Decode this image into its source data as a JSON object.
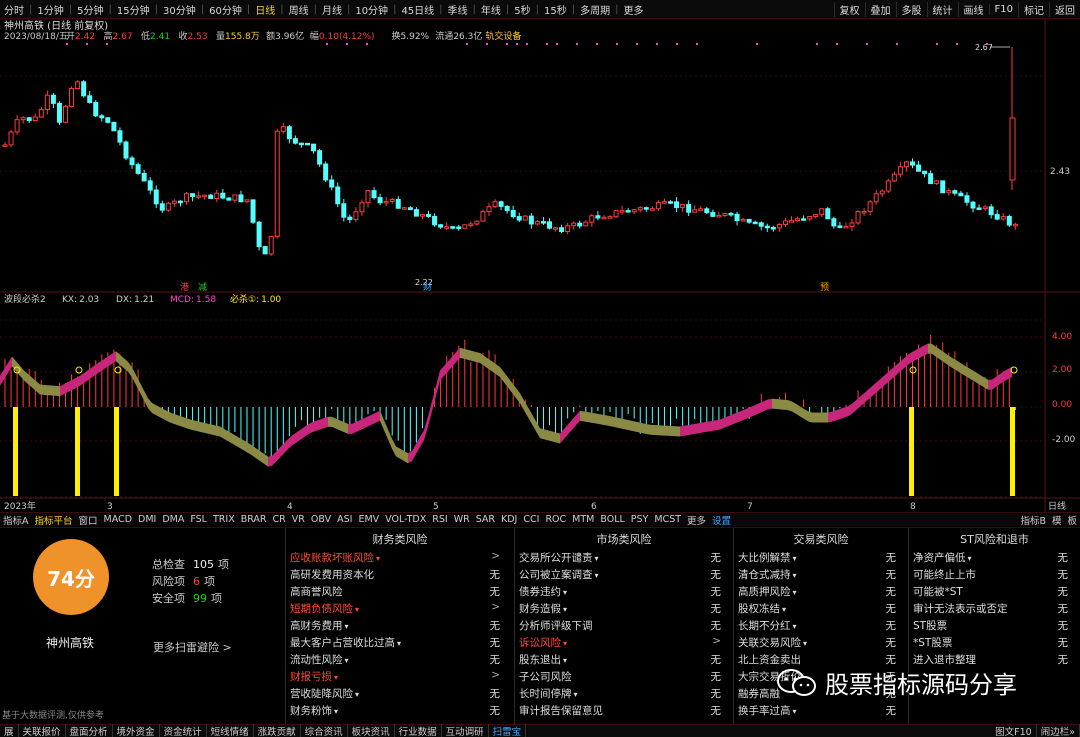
{
  "toolbar": {
    "timeframes": [
      "分时",
      "1分钟",
      "5分钟",
      "15分钟",
      "30分钟",
      "60分钟",
      "日线",
      "周线",
      "月线",
      "10分钟",
      "45日线",
      "季线",
      "年线",
      "5秒",
      "15秒",
      "多周期",
      "更多"
    ],
    "active_timeframe": "日线",
    "right_buttons": [
      "复权",
      "叠加",
      "多股",
      "统计",
      "画线",
      "F10",
      "标记",
      "返回"
    ]
  },
  "quote": {
    "title": "神州高铁 (日线 前复权)",
    "date": "2023/08/18/五",
    "fields": [
      {
        "label": "开",
        "value": "2.42",
        "color": "#ff3b3b"
      },
      {
        "label": "高",
        "value": "2.67",
        "color": "#ff3b3b"
      },
      {
        "label": "低",
        "value": "2.41",
        "color": "#22cc22"
      },
      {
        "label": "收",
        "value": "2.53",
        "color": "#ff3b3b"
      },
      {
        "label": "量",
        "value": "155.8万",
        "color": "#ffcc33"
      },
      {
        "label": "额",
        "value": "3.96亿",
        "color": "#ccc"
      },
      {
        "label": "幅",
        "value": "0.10(4.12%)",
        "color": "#ff3b3b"
      },
      {
        "label": "换",
        "value": "5.92%",
        "color": "#ccc"
      },
      {
        "label": "流通",
        "value": "26.3亿",
        "color": "#ccc"
      }
    ],
    "settings_label": "轨交设备",
    "price_axis": [
      "2.67",
      "2.43"
    ],
    "high_marker": "2.67",
    "low_marker": "2.22",
    "event_markers": [
      "港",
      "减",
      "财",
      "预"
    ]
  },
  "indicator": {
    "name": "波段必杀2",
    "params": [
      {
        "label": "KX:",
        "value": "2.03",
        "color": "#ccc"
      },
      {
        "label": "DX:",
        "value": "1.21",
        "color": "#ccc"
      },
      {
        "label": "MCD:",
        "value": "1.58",
        "color": "#ff44cc"
      },
      {
        "label": "必杀①:",
        "value": "1.00",
        "color": "#ffee00"
      }
    ],
    "axis": [
      "4.00",
      "2.00",
      "0.00",
      "-2.00"
    ]
  },
  "date_axis": {
    "labels": [
      "2023年",
      "3",
      "4",
      "5",
      "6",
      "7",
      "8"
    ],
    "right_label": "日线"
  },
  "indicator_tabs": {
    "items": [
      "指标A",
      "指标平台",
      "窗口",
      "MACD",
      "DMI",
      "DMA",
      "FSL",
      "TRIX",
      "BRAR",
      "CR",
      "VR",
      "OBV",
      "ASI",
      "EMV",
      "VOL-TDX",
      "RSI",
      "WR",
      "SAR",
      "KDJ",
      "CCI",
      "ROC",
      "MTM",
      "BOLL",
      "PSY",
      "MCST",
      "更多",
      "设置"
    ],
    "active": "指标平台",
    "right": [
      "指标B",
      "模",
      "板"
    ]
  },
  "risk": {
    "score": "74分",
    "stock_name": "神州高铁",
    "stats": [
      {
        "label": "总检查",
        "value": "105",
        "unit": "项",
        "color": "#eee"
      },
      {
        "label": "风险项",
        "value": "6",
        "unit": "项",
        "color": "#ff3b3b"
      },
      {
        "label": "安全项",
        "value": "99",
        "unit": "项",
        "color": "#22cc22"
      }
    ],
    "more_scan": "更多扫雷避险 >",
    "columns": [
      {
        "title": "财务类风险",
        "rows": [
          {
            "label": "应收账款坏账风险",
            "val": ">",
            "red": true,
            "arrow": true
          },
          {
            "label": "高研发费用资本化",
            "val": "无"
          },
          {
            "label": "高商誉风险",
            "val": "无"
          },
          {
            "label": "短期负债风险",
            "val": ">",
            "red": true,
            "arrow": true
          },
          {
            "label": "高财务费用",
            "val": "无",
            "arrow": true
          },
          {
            "label": "最大客户占营收比过高",
            "val": "无",
            "arrow": true
          },
          {
            "label": "流动性风险",
            "val": "无",
            "arrow": true
          },
          {
            "label": "财报亏损",
            "val": ">",
            "red": true,
            "arrow": true
          },
          {
            "label": "营收陡降风险",
            "val": "无",
            "arrow": true
          },
          {
            "label": "财务粉饰",
            "val": "无",
            "arrow": true
          }
        ]
      },
      {
        "title": "市场类风险",
        "rows": [
          {
            "label": "交易所公开谴责",
            "val": "无",
            "arrow": true
          },
          {
            "label": "公司被立案调查",
            "val": "无",
            "arrow": true
          },
          {
            "label": "债券违约",
            "val": "无",
            "arrow": true
          },
          {
            "label": "财务造假",
            "val": "无",
            "arrow": true
          },
          {
            "label": "分析师评级下调",
            "val": "无"
          },
          {
            "label": "诉讼风险",
            "val": ">",
            "red": true,
            "arrow": true
          },
          {
            "label": "股东退出",
            "val": "无",
            "arrow": true
          },
          {
            "label": "子公司风险",
            "val": "无"
          },
          {
            "label": "长时间停牌",
            "val": "无",
            "arrow": true
          },
          {
            "label": "审计报告保留意见",
            "val": "无"
          }
        ]
      },
      {
        "title": "交易类风险",
        "rows": [
          {
            "label": "大比例解禁",
            "val": "无",
            "arrow": true
          },
          {
            "label": "清仓式减持",
            "val": "无",
            "arrow": true
          },
          {
            "label": "高质押风险",
            "val": "无",
            "arrow": true
          },
          {
            "label": "股权冻结",
            "val": "无",
            "arrow": true
          },
          {
            "label": "长期不分红",
            "val": "无",
            "arrow": true
          },
          {
            "label": "关联交易风险",
            "val": "无",
            "arrow": true
          },
          {
            "label": "北上资金卖出",
            "val": "无"
          },
          {
            "label": "大宗交易折价",
            "val": "无"
          },
          {
            "label": "融券高融",
            "val": "无"
          },
          {
            "label": "换手率过高",
            "val": "无",
            "arrow": true
          }
        ]
      },
      {
        "title": "ST风险和退市",
        "rows": [
          {
            "label": "净资产偏低",
            "val": "无",
            "arrow": true
          },
          {
            "label": "可能终止上市",
            "val": "无"
          },
          {
            "label": "可能被*ST",
            "val": "无"
          },
          {
            "label": "审计无法表示或否定",
            "val": "无"
          },
          {
            "label": "ST股票",
            "val": "无"
          },
          {
            "label": "*ST股票",
            "val": "无"
          },
          {
            "label": "进入退市整理",
            "val": "无"
          }
        ]
      }
    ],
    "footnote": "基于大数据评测,仅供参考"
  },
  "bottom_bar": {
    "items": [
      "展",
      "关联报价",
      "盘面分析",
      "境外资金",
      "资金统计",
      "短线情绪",
      "涨跌贡献",
      "综合资讯",
      "板块资讯",
      "行业数据",
      "互动调研",
      "扫雷宝"
    ],
    "active": "扫雷宝",
    "right": "图文F10",
    "right2": "闹边栏»"
  },
  "watermark": "股票指标源码分享",
  "colors": {
    "up": "#ff3b3b",
    "down": "#54ffff",
    "accent": "#ffcc33",
    "magenta": "#c8267a",
    "olive": "#8a8a44",
    "yellow": "#ffee00"
  }
}
